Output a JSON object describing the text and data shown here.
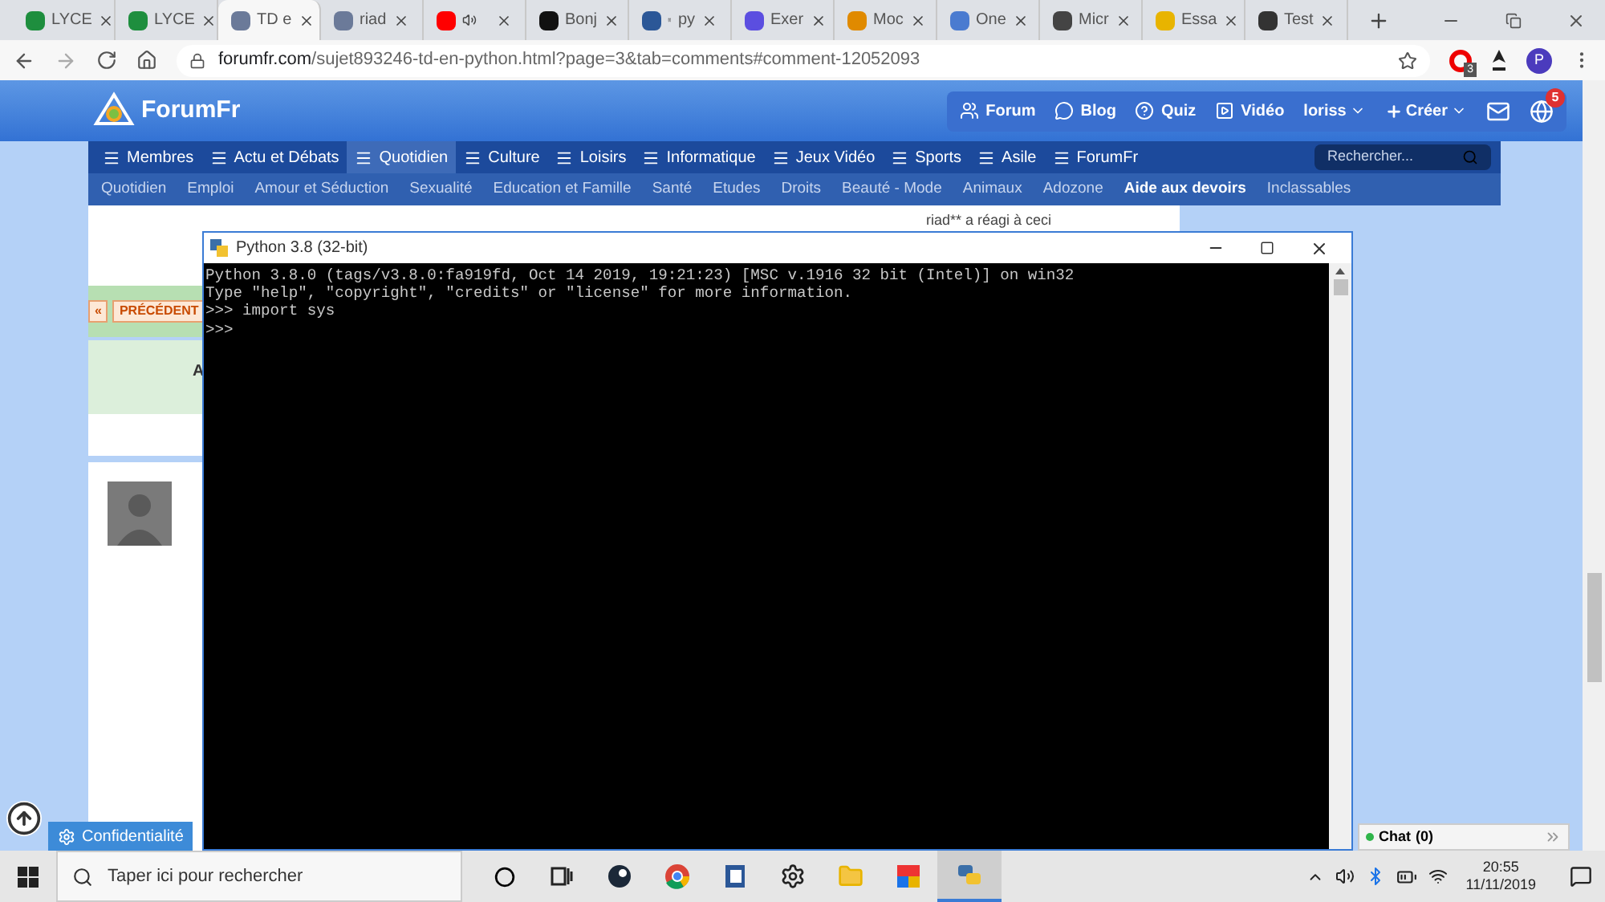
{
  "browser": {
    "tabs": [
      {
        "label": "LYCE",
        "selected": false
      },
      {
        "label": "LYCE",
        "selected": false
      },
      {
        "label": "TD e",
        "selected": true
      },
      {
        "label": "riad",
        "selected": false
      },
      {
        "selected": false
      },
      {
        "label": "Bonj",
        "selected": false
      },
      {
        "label": "py",
        "selected": false
      },
      {
        "label": "Exer",
        "selected": false
      },
      {
        "label": "Moc",
        "selected": false
      },
      {
        "label": "One",
        "selected": false
      },
      {
        "label": "Micr",
        "selected": false
      },
      {
        "label": "Essa",
        "selected": false
      },
      {
        "label": "Test",
        "selected": false
      }
    ],
    "address": {
      "host": "forumfr.com",
      "path": "/sujet893246-td-en-python.html?page=3&tab=comments#comment-12052093"
    },
    "extension_badge": "3",
    "profile": "P"
  },
  "site": {
    "logo": "ForumFr",
    "top_nav": [
      {
        "label": "Forum"
      },
      {
        "label": "Blog"
      },
      {
        "label": "Quiz"
      },
      {
        "label": "Vidéo"
      }
    ],
    "user": "loriss",
    "create": "Créer",
    "notification_count": "5",
    "main_nav": [
      {
        "label": "Membres",
        "selected": false
      },
      {
        "label": "Actu et Débats",
        "selected": false
      },
      {
        "label": "Quotidien",
        "selected": true
      },
      {
        "label": "Culture",
        "selected": false
      },
      {
        "label": "Loisirs",
        "selected": false
      },
      {
        "label": "Informatique",
        "selected": false
      },
      {
        "label": "Jeux Vidéo",
        "selected": false
      },
      {
        "label": "Sports",
        "selected": false
      },
      {
        "label": "Asile",
        "selected": false
      },
      {
        "label": "ForumFr",
        "selected": false
      }
    ],
    "search_placeholder": "Rechercher...",
    "sub_nav": [
      {
        "label": "Quotidien",
        "selected": false
      },
      {
        "label": "Emploi",
        "selected": false
      },
      {
        "label": "Amour et Séduction",
        "selected": false
      },
      {
        "label": "Sexualité",
        "selected": false
      },
      {
        "label": "Education et Famille",
        "selected": false
      },
      {
        "label": "Santé",
        "selected": false
      },
      {
        "label": "Etudes",
        "selected": false
      },
      {
        "label": "Droits",
        "selected": false
      },
      {
        "label": "Beauté - Mode",
        "selected": false
      },
      {
        "label": "Animaux",
        "selected": false
      },
      {
        "label": "Adozone",
        "selected": false
      },
      {
        "label": "Aide aux devoirs",
        "selected": true
      },
      {
        "label": "Inclassables",
        "selected": false
      }
    ]
  },
  "page": {
    "reaction": "riad** a réagi à ceci",
    "pager": [
      "«",
      "PRÉCÉDENT"
    ],
    "post_initial": "A",
    "privacy_button": "Confidentialité",
    "chat": {
      "label": "Chat",
      "count": "(0)"
    }
  },
  "python": {
    "title": "Python 3.8 (32-bit)",
    "lines": [
      "Python 3.8.0 (tags/v3.8.0:fa919fd, Oct 14 2019, 19:21:23) [MSC v.1916 32 bit (Intel)] on win32",
      "Type \"help\", \"copyright\", \"credits\" or \"license\" for more information.",
      ">>> import sys",
      ">>>"
    ]
  },
  "taskbar": {
    "search_placeholder": "Taper ici pour rechercher",
    "time": "20:55",
    "date": "11/11/2019"
  }
}
